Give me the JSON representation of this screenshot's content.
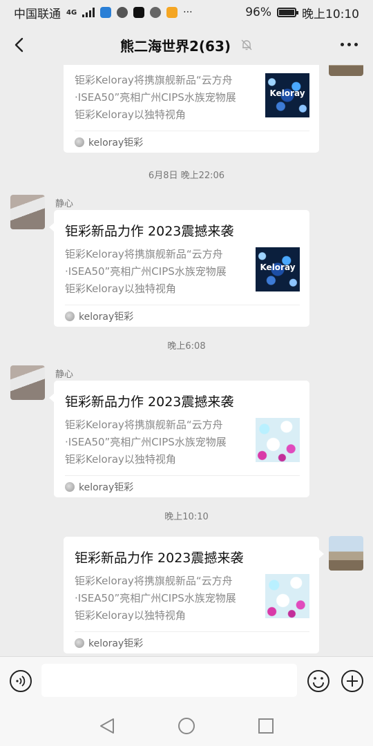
{
  "statusbar": {
    "carrier": "中国联通",
    "network": "4G",
    "battery": "96%",
    "time": "晚上10:10"
  },
  "header": {
    "title": "熊二海世界2(63)"
  },
  "icons": {
    "back": "back-arrow-icon",
    "mute": "bell-off-icon",
    "more": "more-dots-icon",
    "voice": "voice-icon",
    "emoji": "emoji-icon",
    "plus": "plus-icon"
  },
  "messages": [
    {
      "desc": [
        "钜彩Keloray将携旗舰新品“云方舟",
        "·ISEA50”亮相广州CIPS水族宠物展",
        "钜彩Keloray以独特视角"
      ],
      "source": "keloray钜彩",
      "thumb_text": "Keloray",
      "side": "right"
    },
    {
      "time": "6月8日 晚上22:06",
      "sender": "静心",
      "title": "钜彩新品力作 2023震撼来袭",
      "desc": [
        "钜彩Keloray将携旗舰新品“云方舟",
        "·ISEA50”亮相广州CIPS水族宠物展",
        "钜彩Keloray以独特视角"
      ],
      "source": "keloray钜彩",
      "thumb_text": "Keloray",
      "side": "left"
    },
    {
      "time": "晚上6:08",
      "sender": "静心",
      "title": "钜彩新品力作 2023震撼来袭",
      "desc": [
        "钜彩Keloray将携旗舰新品“云方舟",
        "·ISEA50”亮相广州CIPS水族宠物展",
        "钜彩Keloray以独特视角"
      ],
      "source": "keloray钜彩",
      "side": "left"
    },
    {
      "time": "晚上10:10",
      "title": "钜彩新品力作 2023震撼来袭",
      "desc": [
        "钜彩Keloray将携旗舰新品“云方舟",
        "·ISEA50”亮相广州CIPS水族宠物展",
        "钜彩Keloray以独特视角"
      ],
      "source": "keloray钜彩",
      "side": "right"
    }
  ],
  "colors": {
    "background": "#ededed",
    "bubble": "#ffffff",
    "secondary_text": "#888888"
  }
}
